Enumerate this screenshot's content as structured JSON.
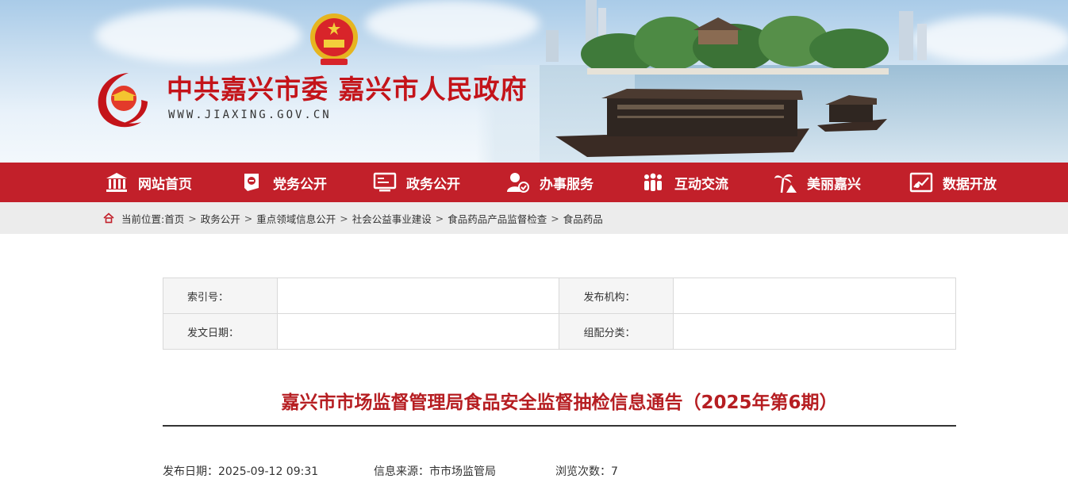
{
  "header": {
    "site_title": "中共嘉兴市委 嘉兴市人民政府",
    "site_url": "WWW.JIAXING.GOV.CN"
  },
  "nav": {
    "items": [
      {
        "label": "网站首页",
        "icon": "home-icon"
      },
      {
        "label": "党务公开",
        "icon": "party-flag-icon"
      },
      {
        "label": "政务公开",
        "icon": "document-board-icon"
      },
      {
        "label": "办事服务",
        "icon": "service-user-icon"
      },
      {
        "label": "互动交流",
        "icon": "people-group-icon"
      },
      {
        "label": "美丽嘉兴",
        "icon": "palm-tree-icon"
      },
      {
        "label": "数据开放",
        "icon": "data-chart-icon"
      }
    ]
  },
  "breadcrumb": {
    "prefix": "当前位置:",
    "items": [
      "首页",
      "政务公开",
      "重点领域信息公开",
      "社会公益事业建设",
      "食品药品产品监督检查",
      "食品药品"
    ],
    "separator": ">"
  },
  "meta": {
    "index_label": "索引号：",
    "index_value": "",
    "publisher_label": "发布机构：",
    "publisher_value": "",
    "date_label": "发文日期：",
    "date_value": "",
    "category_label": "组配分类：",
    "category_value": ""
  },
  "article": {
    "title": "嘉兴市市场监督管理局食品安全监督抽检信息通告（2025年第6期）",
    "publish_date": "发布日期：2025-09-12 09:31",
    "source": "信息来源：市市场监管局",
    "views": "浏览次数：7"
  },
  "colors": {
    "brand_red": "#c2202a",
    "title_red": "#b61e22",
    "crumb_bg": "#ececec"
  }
}
